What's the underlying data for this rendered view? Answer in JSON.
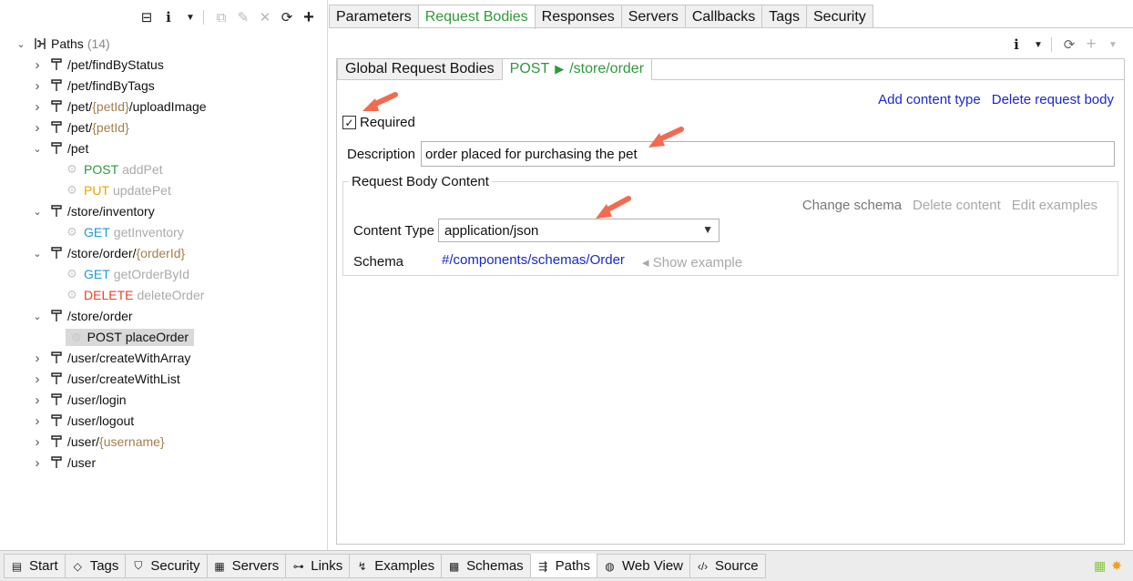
{
  "tree": {
    "root": {
      "label": "Paths",
      "count": "(14)"
    },
    "rows": [
      {
        "segs": [
          {
            "t": "/pet/findByStatus"
          }
        ],
        "expanded": false
      },
      {
        "segs": [
          {
            "t": "/pet/findByTags"
          }
        ],
        "expanded": false
      },
      {
        "segs": [
          {
            "t": "/pet/"
          },
          {
            "t": "{petId}",
            "p": true
          },
          {
            "t": "/uploadImage"
          }
        ],
        "expanded": false
      },
      {
        "segs": [
          {
            "t": "/pet/"
          },
          {
            "t": "{petId}",
            "p": true
          }
        ],
        "expanded": false
      },
      {
        "segs": [
          {
            "t": "/pet"
          }
        ],
        "expanded": true
      },
      {
        "op": true,
        "method": "POST",
        "mclass": "m-post",
        "name": "addPet"
      },
      {
        "op": true,
        "method": "PUT",
        "mclass": "m-put",
        "name": "updatePet"
      },
      {
        "segs": [
          {
            "t": "/store/inventory"
          }
        ],
        "expanded": true
      },
      {
        "op": true,
        "method": "GET",
        "mclass": "m-get",
        "name": "getInventory"
      },
      {
        "segs": [
          {
            "t": "/store/order/"
          },
          {
            "t": "{orderId}",
            "p": true
          }
        ],
        "expanded": true
      },
      {
        "op": true,
        "method": "GET",
        "mclass": "m-get",
        "name": "getOrderById"
      },
      {
        "op": true,
        "method": "DELETE",
        "mclass": "m-delete",
        "name": "deleteOrder"
      },
      {
        "segs": [
          {
            "t": "/store/order"
          }
        ],
        "expanded": true
      },
      {
        "op": true,
        "method": "POST",
        "mclass": "",
        "name": "placeOrder",
        "selected": true
      },
      {
        "segs": [
          {
            "t": "/user/createWithArray"
          }
        ],
        "expanded": false
      },
      {
        "segs": [
          {
            "t": "/user/createWithList"
          }
        ],
        "expanded": false
      },
      {
        "segs": [
          {
            "t": "/user/login"
          }
        ],
        "expanded": false
      },
      {
        "segs": [
          {
            "t": "/user/logout"
          }
        ],
        "expanded": false
      },
      {
        "segs": [
          {
            "t": "/user/"
          },
          {
            "t": "{username}",
            "p": true
          }
        ],
        "expanded": false
      },
      {
        "segs": [
          {
            "t": "/user"
          }
        ],
        "expanded": false
      }
    ]
  },
  "top_tabs": [
    "Parameters",
    "Request Bodies",
    "Responses",
    "Servers",
    "Callbacks",
    "Tags",
    "Security"
  ],
  "active_top_tab": "Request Bodies",
  "inner_tabs": {
    "global": "Global Request Bodies",
    "method": "POST",
    "triangle": "▶",
    "path": "/store/order"
  },
  "body_actions": {
    "add": "Add content type",
    "delete": "Delete request body"
  },
  "required": {
    "label": "Required",
    "checked": true
  },
  "description": {
    "label": "Description",
    "value": "order placed for purchasing the pet"
  },
  "content": {
    "legend": "Request Body Content",
    "change_schema": "Change schema",
    "delete_content": "Delete content",
    "edit_examples": "Edit examples",
    "content_type_label": "Content Type",
    "content_type_value": "application/json",
    "schema_label": "Schema",
    "schema_ref": "#/components/schemas/Order",
    "show_example": "◂ Show example"
  },
  "bottom_tabs": [
    {
      "label": "Start",
      "icon": "▤",
      "name": "start"
    },
    {
      "label": "Tags",
      "icon": "◇",
      "name": "tags"
    },
    {
      "label": "Security",
      "icon": "⛉",
      "name": "security"
    },
    {
      "label": "Servers",
      "icon": "▦",
      "name": "servers"
    },
    {
      "label": "Links",
      "icon": "⊶",
      "name": "links"
    },
    {
      "label": "Examples",
      "icon": "↯",
      "name": "examples"
    },
    {
      "label": "Schemas",
      "icon": "▩",
      "name": "schemas"
    },
    {
      "label": "Paths",
      "icon": "⇶",
      "name": "paths"
    },
    {
      "label": "Web View",
      "icon": "◍",
      "name": "web-view"
    },
    {
      "label": "Source",
      "icon": "‹/›",
      "name": "source"
    }
  ],
  "active_bottom_tab": "Paths",
  "colors": {
    "accent_green": "#2e9a3a",
    "link_blue": "#1a28c8",
    "arrow": "#f26b4f"
  }
}
